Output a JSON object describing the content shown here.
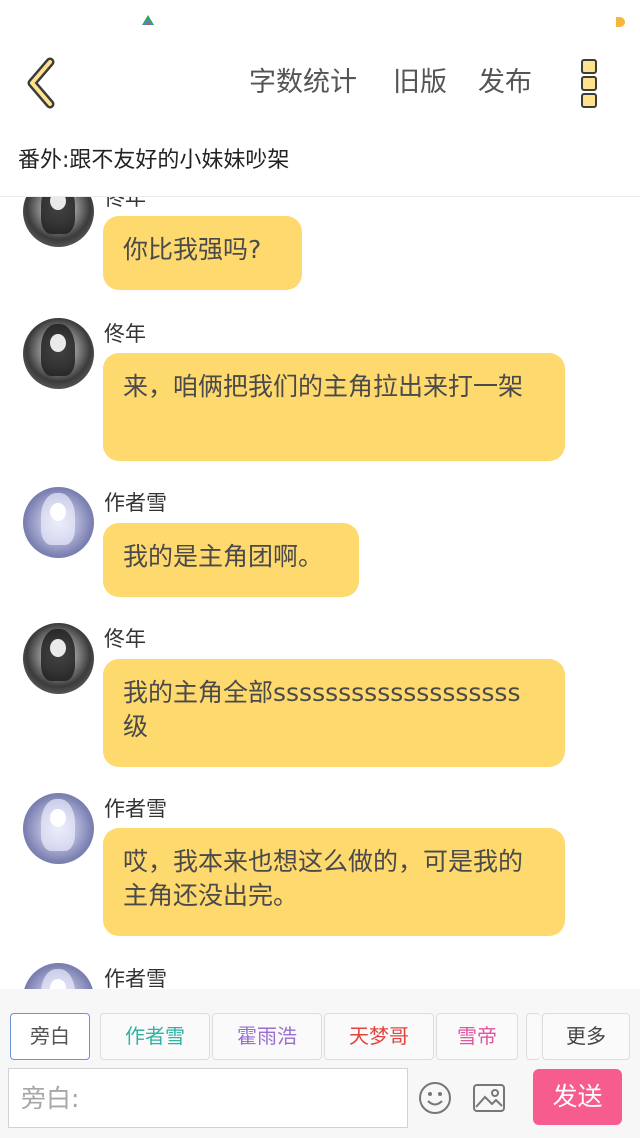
{
  "topbar": {
    "word_count": "字数统计",
    "old_version": "旧版",
    "publish": "发布"
  },
  "chapter_title": "番外:跟不友好的小妹妹吵架",
  "messages": [
    {
      "sender": "佟年",
      "text": "你比我强吗?"
    },
    {
      "sender": "佟年",
      "text": "来，咱俩把我们的主角拉出来打一架"
    },
    {
      "sender": "作者雪",
      "text": "我的是主角团啊。"
    },
    {
      "sender": "佟年",
      "text": "我的主角全部sssssssssssssssssss级"
    },
    {
      "sender": "作者雪",
      "text": "哎，我本来也想这么做的，可是我的主角还没出完。"
    },
    {
      "sender": "作者雪",
      "text": ""
    }
  ],
  "roles": [
    {
      "label": "旁白",
      "color": "#555555",
      "selected": true
    },
    {
      "label": "作者雪",
      "color": "#2fb3a3"
    },
    {
      "label": "霍雨浩",
      "color": "#9b6fd0"
    },
    {
      "label": "天梦哥",
      "color": "#e0453d"
    },
    {
      "label": "雪帝",
      "color": "#e056a0"
    }
  ],
  "more_label": "更多",
  "input": {
    "placeholder": "旁白:",
    "value": ""
  },
  "send_label": "发送",
  "colors": {
    "bubble": "#fdd96e",
    "send": "#f75c8f",
    "accent": "#ffe38a"
  }
}
